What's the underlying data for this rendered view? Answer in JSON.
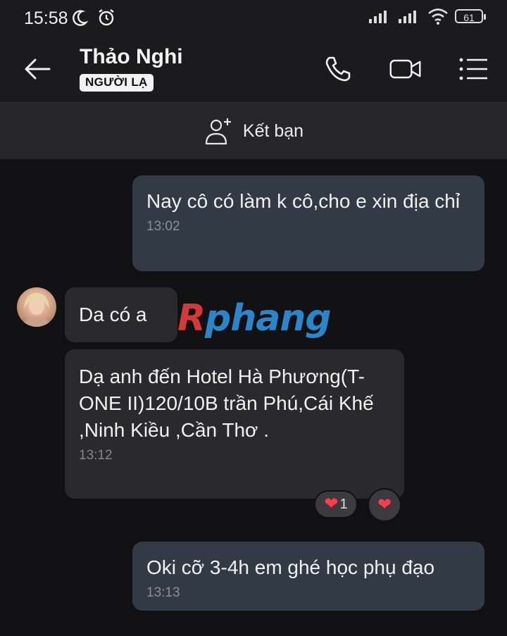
{
  "status_bar": {
    "time": "15:58",
    "battery": "61"
  },
  "header": {
    "name": "Thảo Nghi",
    "badge": "NGƯỜI LẠ"
  },
  "add_friend": {
    "label": "Kết bạn"
  },
  "messages": [
    {
      "direction": "out",
      "text": "Nay cô có làm k cô,cho e xin địa chỉ",
      "time": "13:02"
    },
    {
      "direction": "in",
      "text": "Da có a"
    },
    {
      "direction": "in",
      "text": "Dạ anh đến Hotel Hà Phương(T-ONE II)120/10B trần Phú,Cái Khế ,Ninh Kiều ,Cần Thơ .",
      "time": "13:12"
    },
    {
      "direction": "out",
      "text": "Oki cỡ 3-4h em ghé học phụ đạo",
      "time": "13:13"
    }
  ],
  "reactions": {
    "count": "1"
  },
  "watermark": {
    "first": "R",
    "rest": "phang"
  },
  "colors": {
    "outgoing_bubble": "#323a45",
    "incoming_bubble": "#2a2a2c",
    "background": "#111113",
    "heart": "#ff3b4e"
  },
  "icons": [
    "moon-icon",
    "alarm-icon",
    "signal-icon",
    "wifi-icon",
    "battery-icon",
    "back-arrow-icon",
    "phone-icon",
    "video-icon",
    "menu-list-icon",
    "add-user-icon",
    "heart-icon"
  ]
}
